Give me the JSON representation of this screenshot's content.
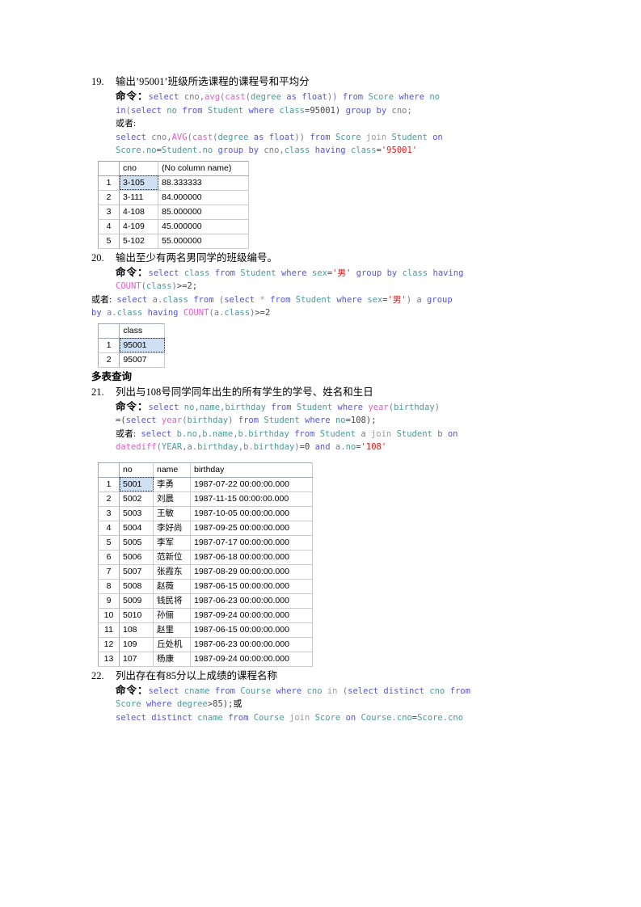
{
  "labels": {
    "command": "命令：",
    "alternative": "或者：",
    "alternative_inline": "或者:",
    "or_short": "或"
  },
  "sections": [
    {
      "number": "19.",
      "title": "输出’95001’班级所选课程的课程号和平均分",
      "code_line1": "select cno,avg(cast(degree as float)) from Score where no in(select no from Student where class=95001) group by cno;",
      "alt_label": "或者:",
      "code_line2": "select cno,AVG(cast(degree as float)) from Score join Student on Score.no=Student.no group by cno,class having class='95001'"
    },
    {
      "number": "20.",
      "title": "输出至少有两名男同学的班级编号。",
      "code_line1": "select class from Student where sex='男' group by class having COUNT(class)>=2;",
      "alt_label": "或者:",
      "code_line2": "select a.class from (select * from Student where sex='男') a group by a.class having COUNT(a.class)>=2"
    },
    {
      "number": "21.",
      "title": "列出与108号同学同年出生的所有学生的学号、姓名和生日",
      "code_line1": "select no,name,birthday from Student where year(birthday)=(select year(birthday) from Student where no=108);",
      "alt_label": "或者:",
      "code_line2": "select b.no,b.name,b.birthday from Student a join Student b on datediff(YEAR,a.birthday,b.birthday)=0 and a.no='108'"
    },
    {
      "number": "22.",
      "title": "列出存在有85分以上成绩的课程名称",
      "code_line1": "select cname from Course where cno in (select distinct cno from Score where degree>85);或",
      "code_line2": "select distinct cname from Course join Score on Course.cno=Score.cno"
    }
  ],
  "subheading": "多表查询",
  "tables": {
    "avg_by_cno": {
      "columns": [
        "",
        "cno",
        "(No column name)"
      ],
      "rows": [
        {
          "n": "1",
          "cno": "3-105",
          "value": "88.333333",
          "selected": true
        },
        {
          "n": "2",
          "cno": "3-111",
          "value": "84.000000",
          "selected": false
        },
        {
          "n": "3",
          "cno": "4-108",
          "value": "85.000000",
          "selected": false
        },
        {
          "n": "4",
          "cno": "4-109",
          "value": "45.000000",
          "selected": false
        },
        {
          "n": "5",
          "cno": "5-102",
          "value": "55.000000",
          "selected": false
        }
      ]
    },
    "class_list": {
      "columns": [
        "",
        "class"
      ],
      "rows": [
        {
          "n": "1",
          "class": "95001",
          "selected": true
        },
        {
          "n": "2",
          "class": "95007",
          "selected": false
        }
      ]
    },
    "students_same_year": {
      "columns": [
        "",
        "no",
        "name",
        "birthday"
      ],
      "rows": [
        {
          "n": "1",
          "no": "5001",
          "name": "李勇",
          "birthday": "1987-07-22 00:00:00.000",
          "selected": true
        },
        {
          "n": "2",
          "no": "5002",
          "name": "刘晨",
          "birthday": "1987-11-15 00:00:00.000",
          "selected": false
        },
        {
          "n": "3",
          "no": "5003",
          "name": "王敏",
          "birthday": "1987-10-05 00:00:00.000",
          "selected": false
        },
        {
          "n": "4",
          "no": "5004",
          "name": "李好尚",
          "birthday": "1987-09-25 00:00:00.000",
          "selected": false
        },
        {
          "n": "5",
          "no": "5005",
          "name": "李军",
          "birthday": "1987-07-17 00:00:00.000",
          "selected": false
        },
        {
          "n": "6",
          "no": "5006",
          "name": "范新位",
          "birthday": "1987-06-18 00:00:00.000",
          "selected": false
        },
        {
          "n": "7",
          "no": "5007",
          "name": "张霞东",
          "birthday": "1987-08-29 00:00:00.000",
          "selected": false
        },
        {
          "n": "8",
          "no": "5008",
          "name": "赵薇",
          "birthday": "1987-06-15 00:00:00.000",
          "selected": false
        },
        {
          "n": "9",
          "no": "5009",
          "name": "钱民将",
          "birthday": "1987-06-23 00:00:00.000",
          "selected": false
        },
        {
          "n": "10",
          "no": "5010",
          "name": "孙俪",
          "birthday": "1987-09-24 00:00:00.000",
          "selected": false
        },
        {
          "n": "11",
          "no": "108",
          "name": "赵里",
          "birthday": "1987-06-15 00:00:00.000",
          "selected": false
        },
        {
          "n": "12",
          "no": "109",
          "name": "丘处机",
          "birthday": "1987-06-23 00:00:00.000",
          "selected": false
        },
        {
          "n": "13",
          "no": "107",
          "name": "杨康",
          "birthday": "1987-09-24 00:00:00.000",
          "selected": false
        }
      ]
    }
  },
  "colors": {
    "keyword": "#5555dd",
    "identifier": "#4b9a9a",
    "function": "#e060c8",
    "string": "#ee1111",
    "dim": "#9a9a9a",
    "grid_border": "#9fa8b4",
    "selection": "#cfe0f2"
  }
}
